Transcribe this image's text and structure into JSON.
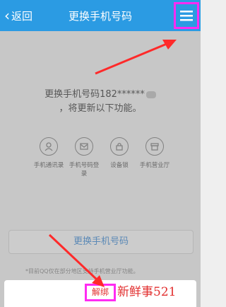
{
  "header": {
    "back_label": "返回",
    "title": "更换手机号码"
  },
  "info": {
    "line1": "更换手机号码182******",
    "line2": "，将更新以下功能。"
  },
  "features": [
    {
      "label": "手机通讯录",
      "icon": "contacts-icon"
    },
    {
      "label": "手机号码登录",
      "icon": "phone-login-icon"
    },
    {
      "label": "设备锁",
      "icon": "lock-icon"
    },
    {
      "label": "手机营业厅",
      "icon": "store-icon"
    }
  ],
  "change_button": "更换手机号码",
  "note": "*目前QQ仅在部分地区支持手机营业厅功能。",
  "unbind_button": "解绑",
  "watermark": "新鲜事521",
  "colors": {
    "header": "#2b9be3",
    "highlight": "#ff2bf2",
    "arrow": "#ff2a2a",
    "unbind_text": "#e23030"
  }
}
